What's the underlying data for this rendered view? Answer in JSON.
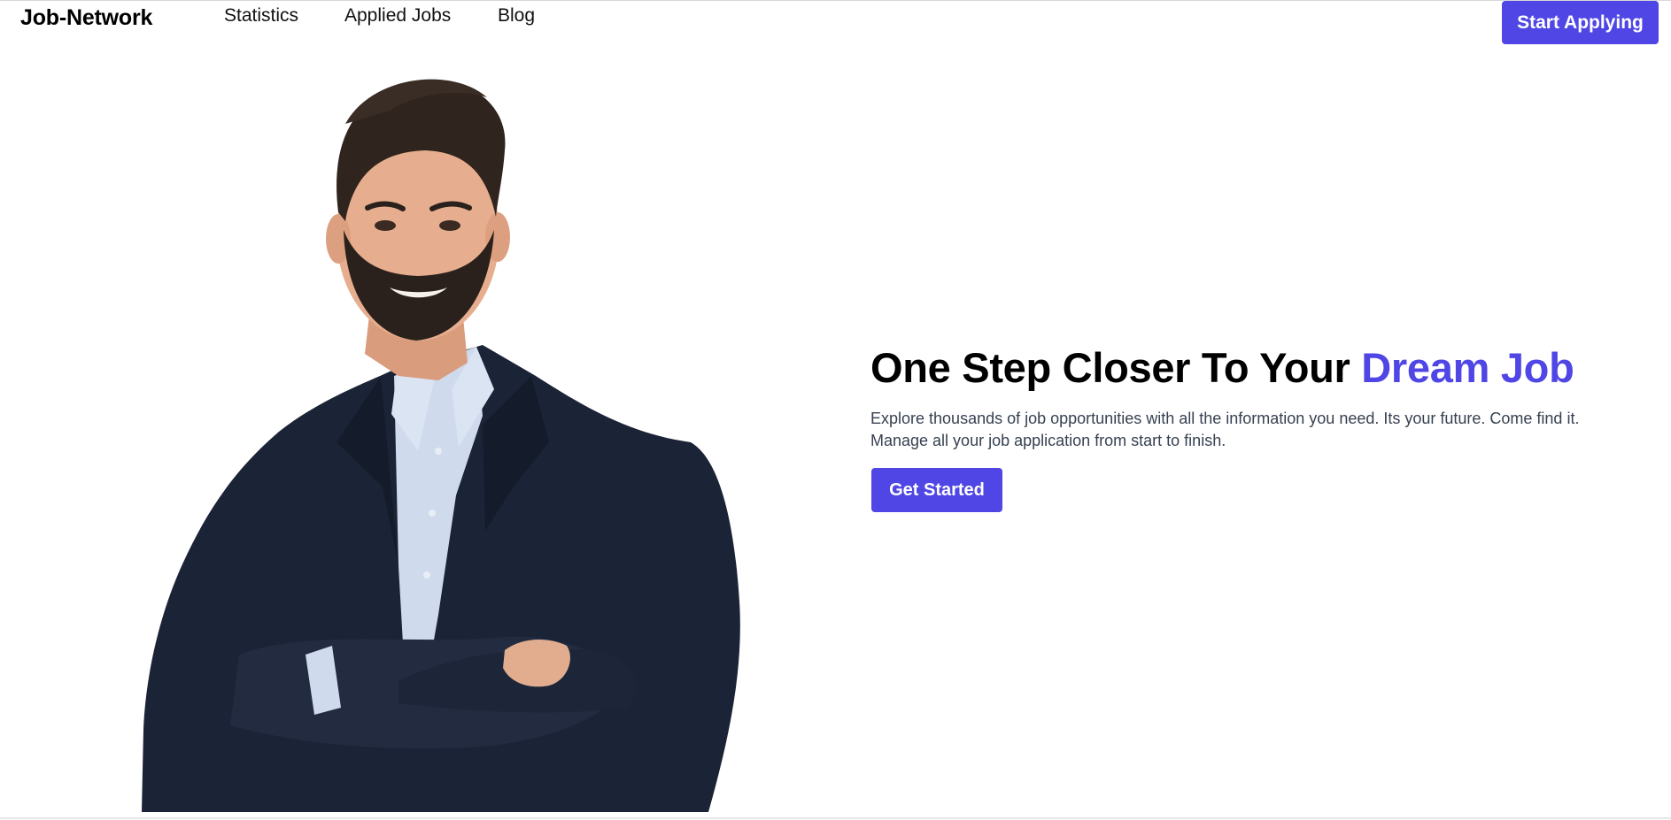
{
  "nav": {
    "brand": "Job-Network",
    "links": [
      "Statistics",
      "Applied Jobs",
      "Blog"
    ],
    "cta_label": "Start Applying"
  },
  "hero": {
    "title_prefix": "One Step Closer To Your ",
    "title_accent": "Dream Job",
    "description": "Explore thousands of job opportunities with all the information you need. Its your future. Come find it. Manage all your job application from start to finish.",
    "button_label": "Get Started",
    "image_subject": "smiling-man-portrait"
  },
  "colors": {
    "accent": "#4f46e5",
    "text": "#000000",
    "muted_text": "#374151",
    "background": "#ffffff"
  }
}
